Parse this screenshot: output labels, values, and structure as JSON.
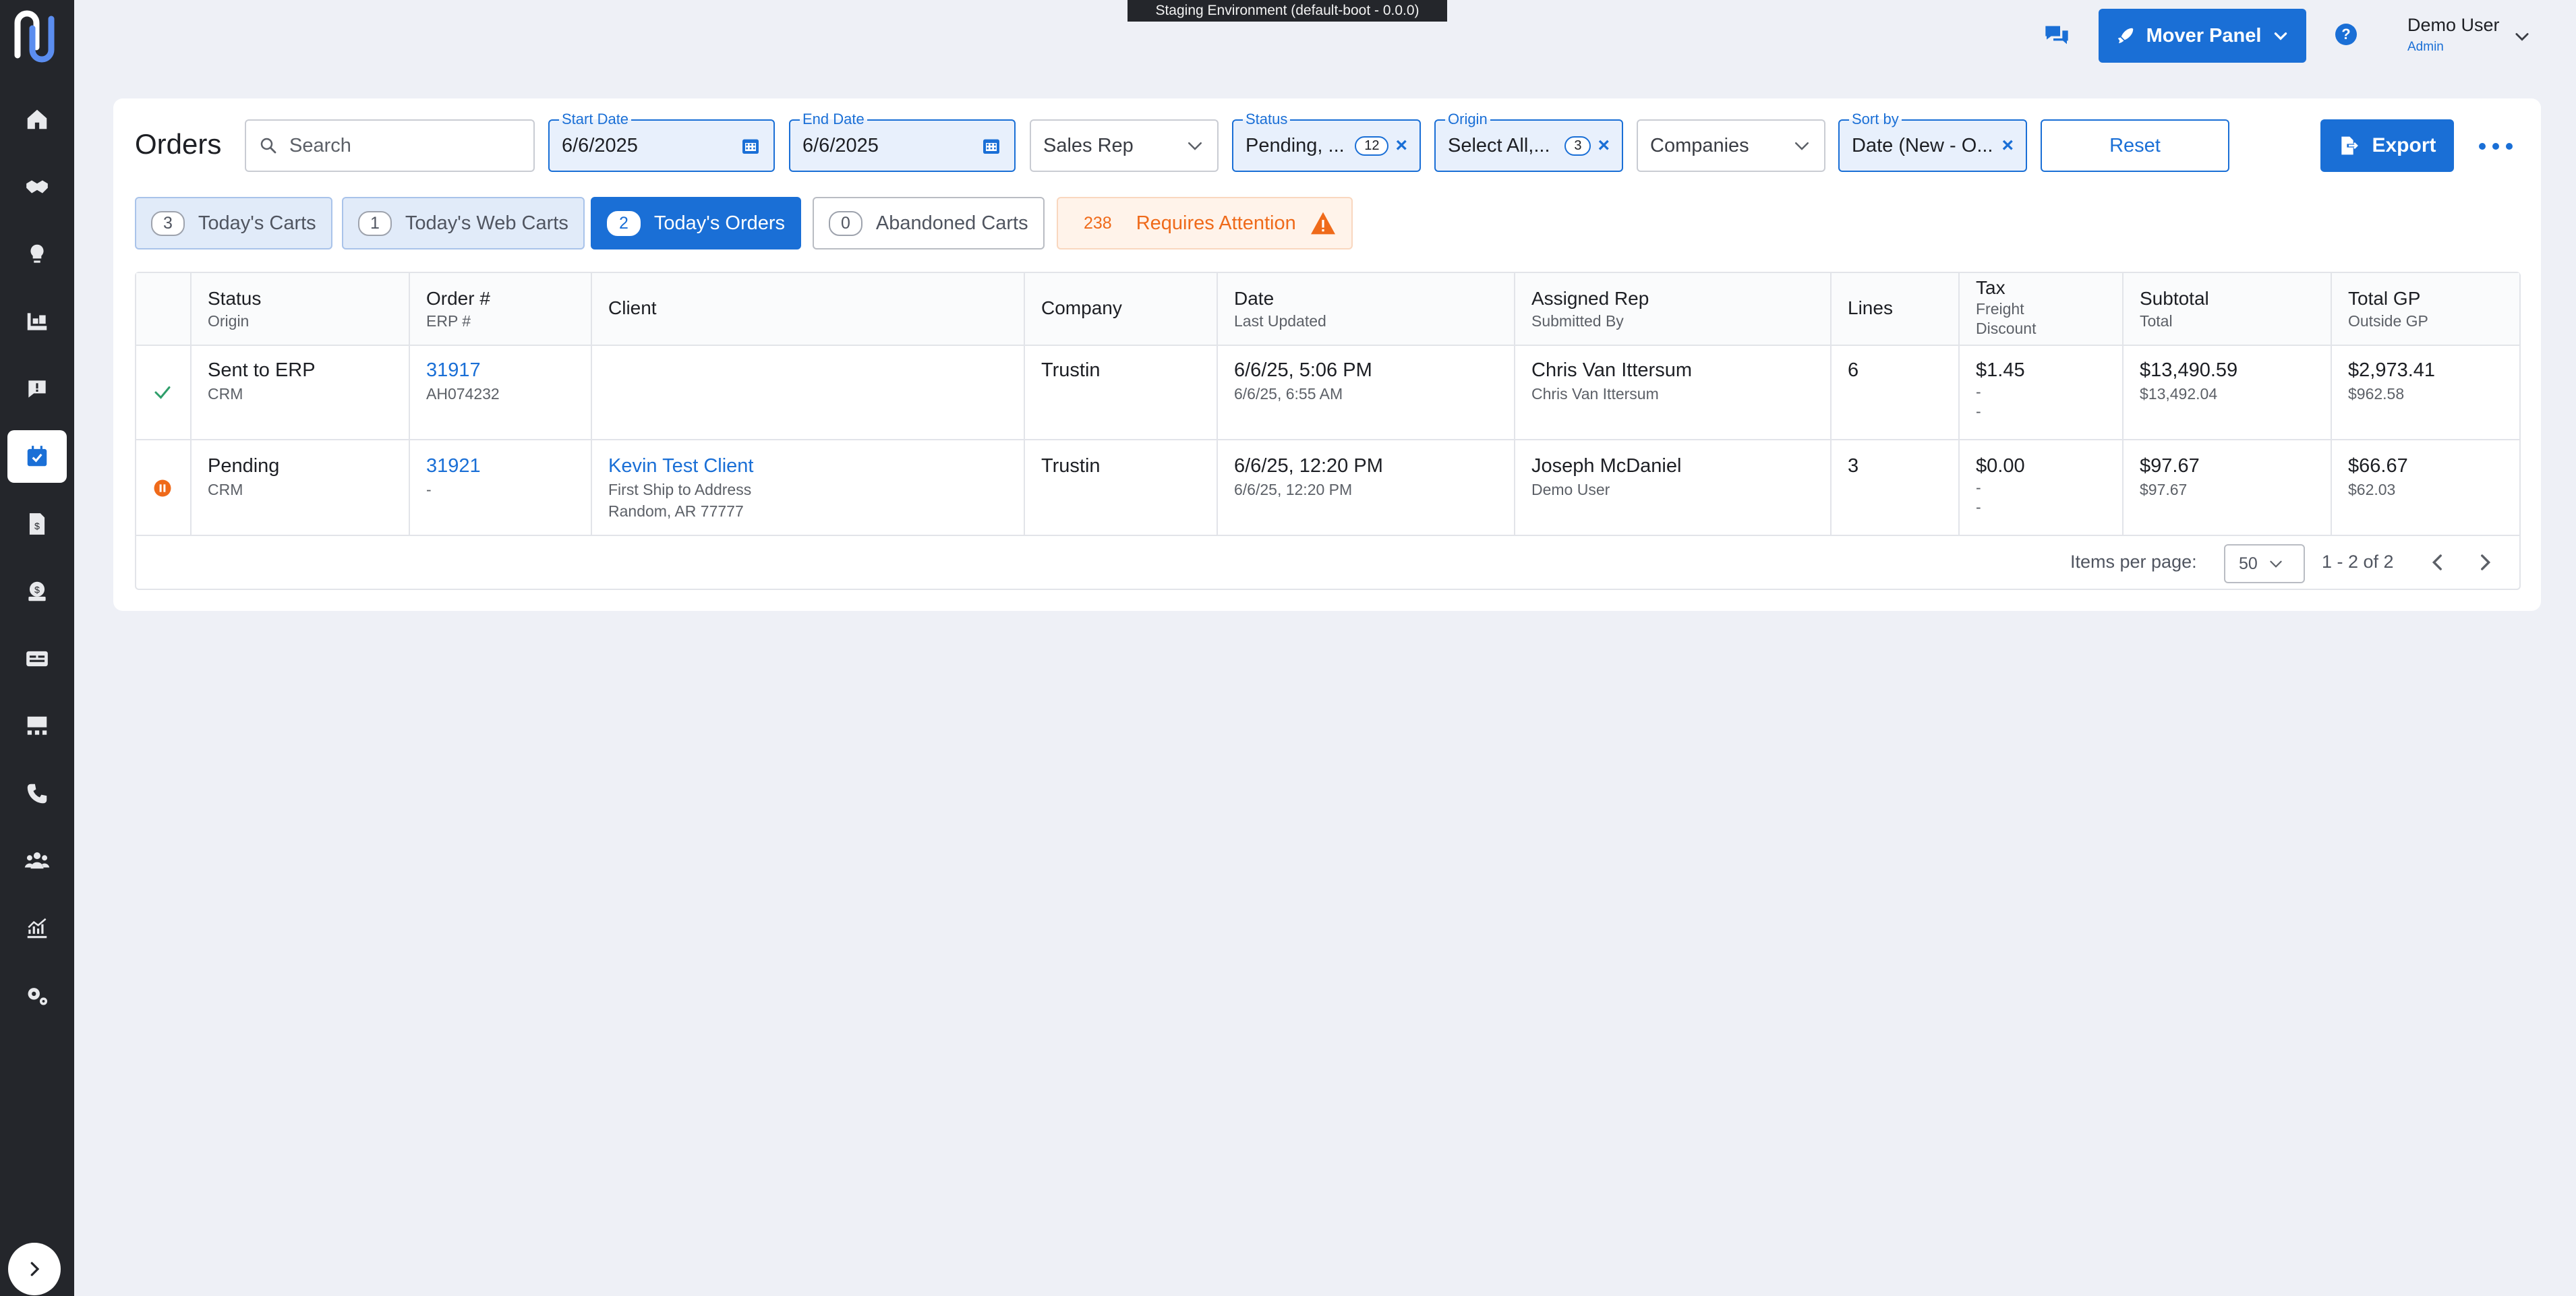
{
  "env_banner": "Staging Environment (default-boot - 0.0.0)",
  "header": {
    "mover_panel_label": "Mover Panel",
    "help_label": "?",
    "user_name": "Demo User",
    "user_role": "Admin"
  },
  "sidebar": {
    "items": [
      {
        "icon": "home-icon"
      },
      {
        "icon": "handshake-icon"
      },
      {
        "icon": "lightbulb-icon"
      },
      {
        "icon": "warehouse-icon"
      },
      {
        "icon": "feedback-icon"
      },
      {
        "icon": "calendar-check-icon",
        "active": true
      },
      {
        "icon": "invoice-icon"
      },
      {
        "icon": "money-icon"
      },
      {
        "icon": "card-icon"
      },
      {
        "icon": "org-chart-icon"
      },
      {
        "icon": "phone-icon"
      },
      {
        "icon": "people-icon"
      },
      {
        "icon": "analytics-icon"
      },
      {
        "icon": "settings-icon"
      }
    ]
  },
  "page": {
    "title": "Orders",
    "search_placeholder": "Search",
    "start_date": {
      "label": "Start Date",
      "value": "6/6/2025"
    },
    "end_date": {
      "label": "End Date",
      "value": "6/6/2025"
    },
    "sales_rep": {
      "value": "Sales Rep"
    },
    "status": {
      "label": "Status",
      "value": "Pending, ...",
      "count": "12"
    },
    "origin": {
      "label": "Origin",
      "value": "Select All,...",
      "count": "3"
    },
    "companies": {
      "value": "Companies"
    },
    "sort_by": {
      "label": "Sort by",
      "value": "Date (New - O..."
    },
    "reset_label": "Reset",
    "export_label": "Export"
  },
  "tabs": [
    {
      "count": "3",
      "label": "Today's Carts"
    },
    {
      "count": "1",
      "label": "Today's Web Carts"
    },
    {
      "count": "2",
      "label": "Today's Orders"
    },
    {
      "count": "0",
      "label": "Abandoned Carts"
    },
    {
      "count": "238",
      "label": "Requires Attention"
    }
  ],
  "table": {
    "headers": {
      "status": {
        "main": "Status",
        "sub": "Origin"
      },
      "order": {
        "main": "Order #",
        "sub": "ERP #"
      },
      "client": {
        "main": "Client"
      },
      "company": {
        "main": "Company"
      },
      "date": {
        "main": "Date",
        "sub": "Last Updated"
      },
      "rep": {
        "main": "Assigned Rep",
        "sub": "Submitted By"
      },
      "lines": {
        "main": "Lines"
      },
      "tax": {
        "main": "Tax",
        "sub": "Freight",
        "sub2": "Discount"
      },
      "subtotal": {
        "main": "Subtotal",
        "sub": "Total"
      },
      "gp": {
        "main": "Total GP",
        "sub": "Outside GP"
      }
    },
    "rows": [
      {
        "status": "Sent to ERP",
        "origin": "CRM",
        "order": "31917",
        "erp": "AH074232",
        "client": "",
        "client_addr1": "",
        "client_addr2": "",
        "company": "Trustin",
        "date": "6/6/25, 5:06 PM",
        "updated": "6/6/25, 6:55 AM",
        "rep": "Chris Van Ittersum",
        "submitted": "Chris Van Ittersum",
        "lines": "6",
        "tax": "$1.45",
        "freight": "-",
        "discount": "-",
        "subtotal": "$13,490.59",
        "total": "$13,492.04",
        "gp": "$2,973.41",
        "outside_gp": "$962.58"
      },
      {
        "status": "Pending",
        "origin": "CRM",
        "order": "31921",
        "erp": "-",
        "client": "Kevin Test Client",
        "client_addr1": "First Ship to Address",
        "client_addr2": "Random, AR 77777",
        "company": "Trustin",
        "date": "6/6/25, 12:20 PM",
        "updated": "6/6/25, 12:20 PM",
        "rep": "Joseph McDaniel",
        "submitted": "Demo User",
        "lines": "3",
        "tax": "$0.00",
        "freight": "-",
        "discount": "-",
        "subtotal": "$97.67",
        "total": "$97.67",
        "gp": "$66.67",
        "outside_gp": "$62.03"
      }
    ]
  },
  "pagination": {
    "items_per_page_label": "Items per page:",
    "items_per_page": "50",
    "range": "1 - 2 of 2"
  },
  "colors": {
    "primary": "#1a6fd6",
    "sidebar": "#24262b",
    "success": "#2e9e6a",
    "warning": "#ef6a1a"
  }
}
